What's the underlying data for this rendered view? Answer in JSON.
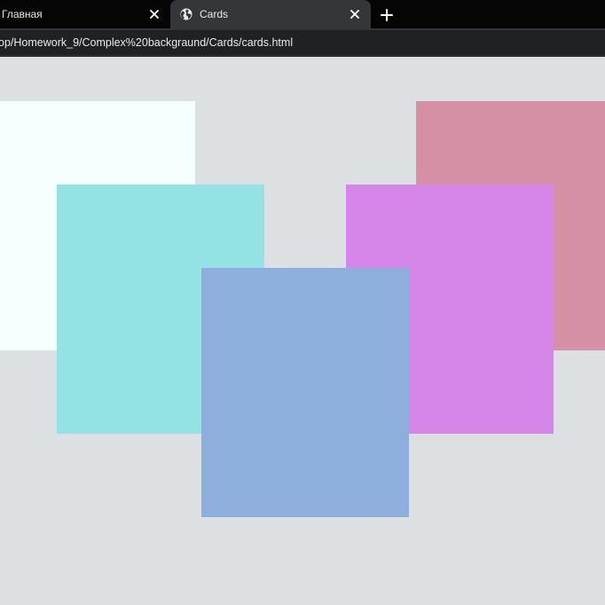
{
  "tabs": [
    {
      "title": "Главная",
      "active": false
    },
    {
      "title": "Cards",
      "active": true
    }
  ],
  "address_bar": {
    "url": "op/Homework_9/Complex%20backgraund/Cards/cards.html"
  },
  "icons": {
    "tab_close": "close-icon",
    "favicon": "globe-icon",
    "new_tab": "plus-icon"
  },
  "page": {
    "background": "#dde0e3",
    "cards": [
      {
        "color": "#f5ffff"
      },
      {
        "color": "#93e3e5"
      },
      {
        "color": "#8eafdc"
      },
      {
        "color": "#d590a6"
      },
      {
        "color": "#d686e8"
      }
    ]
  }
}
